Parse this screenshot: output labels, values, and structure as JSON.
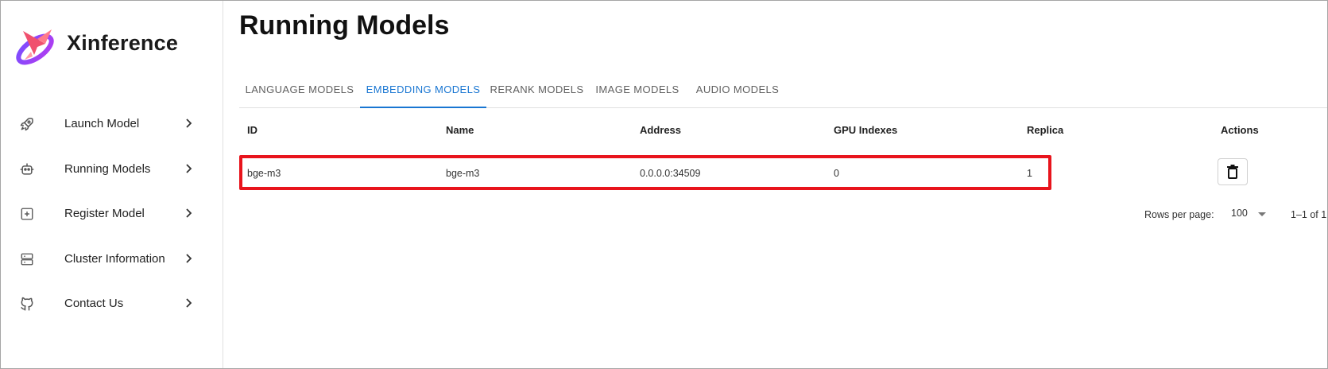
{
  "brand": {
    "name": "Xinference"
  },
  "sidebar": {
    "items": [
      {
        "label": "Launch Model",
        "icon": "rocket-icon"
      },
      {
        "label": "Running Models",
        "icon": "robot-icon"
      },
      {
        "label": "Register Model",
        "icon": "plus-square-icon"
      },
      {
        "label": "Cluster Information",
        "icon": "server-icon"
      },
      {
        "label": "Contact Us",
        "icon": "github-icon"
      }
    ]
  },
  "page": {
    "title": "Running Models"
  },
  "tabs": [
    {
      "label": "LANGUAGE MODELS",
      "active": false
    },
    {
      "label": "EMBEDDING MODELS",
      "active": true
    },
    {
      "label": "RERANK MODELS",
      "active": false
    },
    {
      "label": "IMAGE MODELS",
      "active": false
    },
    {
      "label": "AUDIO MODELS",
      "active": false
    }
  ],
  "table": {
    "headers": [
      "ID",
      "Name",
      "Address",
      "GPU Indexes",
      "Replica",
      "Actions"
    ],
    "rows": [
      {
        "id": "bge-m3",
        "name": "bge-m3",
        "address": "0.0.0.0:34509",
        "gpu_indexes": "0",
        "replica": "1"
      }
    ]
  },
  "pagination": {
    "rows_per_page_label": "Rows per page:",
    "rows_per_page": "100",
    "range": "1–1 of 1"
  },
  "colors": {
    "accent": "#1976d2",
    "highlight_border": "#e8141c"
  }
}
